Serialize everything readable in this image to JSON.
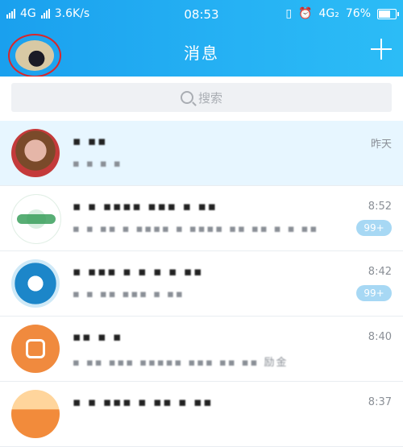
{
  "status_bar": {
    "network_left": "4G",
    "speed": "3.6K/s",
    "time": "08:53",
    "network_right": "4G₂",
    "battery": "76%",
    "battery_level": 0.76
  },
  "header": {
    "title": "消息",
    "add_icon": "plus-icon"
  },
  "search": {
    "placeholder": "搜索",
    "icon": "search-icon"
  },
  "conversations": [
    {
      "name": "▪ ▪▪",
      "preview": "▪ ▪ ▪ ▪",
      "time": "昨天",
      "badge": "",
      "pinned": true,
      "avatar_colors": [
        "#7a4a2a",
        "#e5b6a8",
        "#c43a3a"
      ]
    },
    {
      "name": "▪ ▪ ▪▪▪▪ ▪▪▪ ▪ ▪▪",
      "preview": "▪ ▪ ▪▪ ▪ ▪▪▪▪ ▪ ▪▪▪▪ ▪▪ ▪▪ ▪ ▪ ▪▪",
      "time": "8:52",
      "badge": "99+",
      "pinned": false,
      "avatar_colors": [
        "#2e9a52",
        "#d9efe1"
      ]
    },
    {
      "name": "▪ ▪▪▪ ▪ ▪ ▪ ▪ ▪▪",
      "preview": "▪ ▪ ▪▪ ▪▪▪ ▪ ▪▪",
      "time": "8:42",
      "badge": "99+",
      "pinned": false,
      "avatar_colors": [
        "#1c86c9",
        "#cfe9f7"
      ]
    },
    {
      "name": "▪▪ ▪ ▪",
      "preview": "▪ ▪▪ ▪▪▪ ▪▪▪▪▪ ▪▪▪ ▪▪ ▪▪ 励金",
      "time": "8:40",
      "badge": "",
      "pinned": false,
      "avatar_colors": [
        "#f08a3e",
        "#fff"
      ]
    },
    {
      "name": "▪ ▪ ▪▪▪ ▪ ▪▪ ▪ ▪▪",
      "preview": "",
      "time": "8:37",
      "badge": "",
      "pinned": false,
      "avatar_colors": [
        "#f28b3b",
        "#ffd59c"
      ]
    }
  ]
}
